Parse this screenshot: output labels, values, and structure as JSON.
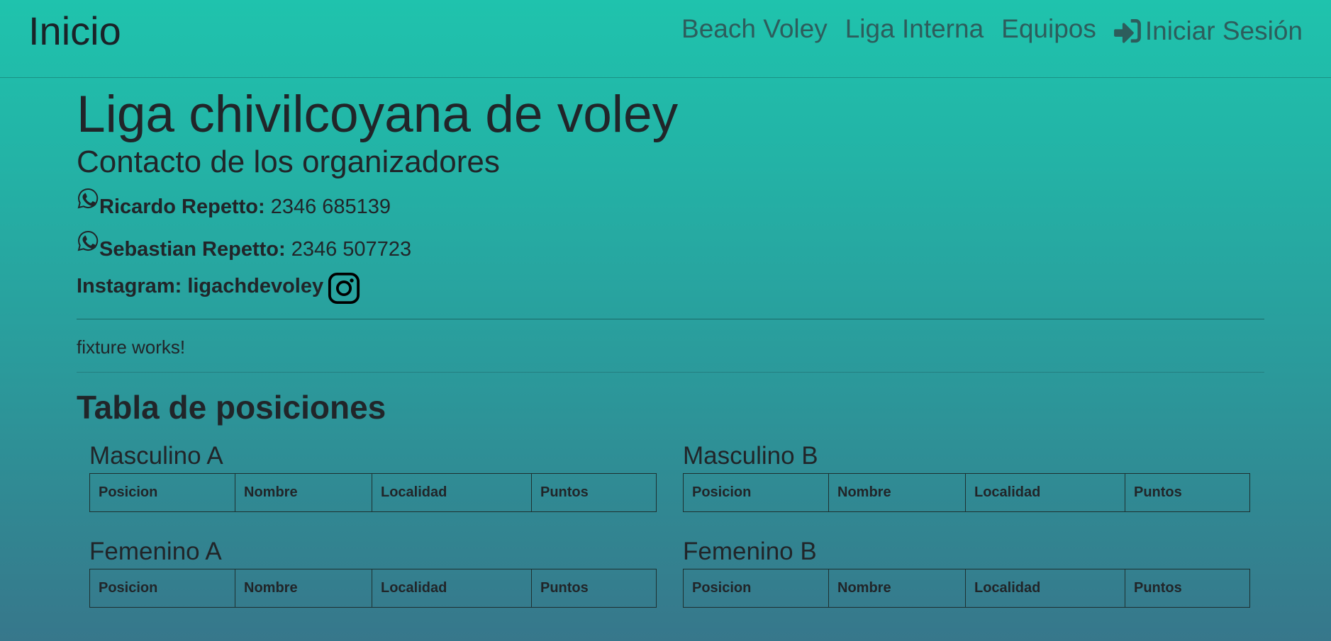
{
  "navbar": {
    "brand": "Inicio",
    "links": [
      "Beach Voley",
      "Liga Interna",
      "Equipos"
    ],
    "login_label": "Iniciar Sesión"
  },
  "header": {
    "title": "Liga chivilcoyana de voley",
    "subtitle": "Contacto de los organizadores"
  },
  "contacts": [
    {
      "name": "Ricardo Repetto:",
      "phone": "2346 685139",
      "icon": "whatsapp-icon"
    },
    {
      "name": "Sebastian Repetto:",
      "phone": "2346 507723",
      "icon": "whatsapp-icon"
    }
  ],
  "instagram": {
    "label": "Instagram: ligachdevoley",
    "icon": "instagram-icon"
  },
  "fixture_text": "fixture works!",
  "standings": {
    "title": "Tabla de posiciones",
    "columns": [
      "Posicion",
      "Nombre",
      "Localidad",
      "Puntos"
    ],
    "tables": [
      {
        "title": "Masculino A"
      },
      {
        "title": "Masculino B"
      },
      {
        "title": "Femenino A"
      },
      {
        "title": "Femenino B"
      }
    ]
  },
  "colors": {
    "gradient_top": "#1fc3ad",
    "gradient_bottom": "#37778b",
    "nav_link": "#2d5d5c",
    "text": "#212529"
  }
}
